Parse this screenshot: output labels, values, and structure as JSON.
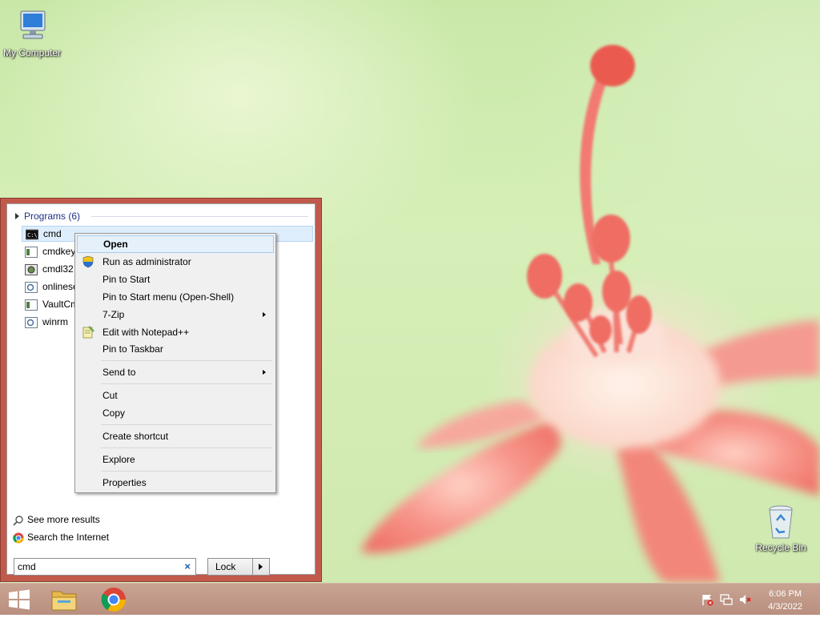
{
  "desktop": {
    "icons": [
      {
        "label": "My Computer",
        "icon": "computer-icon"
      },
      {
        "label": "Recycle Bin",
        "icon": "recycle-bin-icon"
      }
    ]
  },
  "start_menu": {
    "programs_header": "Programs (6)",
    "results": [
      {
        "label": "cmd",
        "icon": "console-icon",
        "selected": true
      },
      {
        "label": "cmdkey",
        "icon": "app-window-icon"
      },
      {
        "label": "cmdl32",
        "icon": "cmdl32-icon"
      },
      {
        "label": "onlinese",
        "icon": "gear-window-icon"
      },
      {
        "label": "VaultCm",
        "icon": "app-window-icon"
      },
      {
        "label": "winrm",
        "icon": "gear-window-icon"
      }
    ],
    "see_more": "See more results",
    "search_internet": "Search the Internet",
    "search": {
      "value": "cmd",
      "clear": "×"
    },
    "lock_label": "Lock"
  },
  "context_menu": {
    "items": [
      {
        "label": "Open",
        "bold": true,
        "highlighted": true
      },
      {
        "label": "Run as administrator",
        "icon": "uac-shield-icon"
      },
      {
        "label": "Pin to Start"
      },
      {
        "label": "Pin to Start menu (Open-Shell)"
      },
      {
        "label": "7-Zip",
        "submenu": true
      },
      {
        "label": "Edit with Notepad++",
        "icon": "notepad-plus-plus-icon"
      },
      {
        "label": "Pin to Taskbar"
      },
      {
        "label": "Send to",
        "submenu": true
      },
      {
        "label": "Cut"
      },
      {
        "label": "Copy"
      },
      {
        "label": "Create shortcut"
      },
      {
        "label": "Explore"
      },
      {
        "label": "Properties"
      }
    ]
  },
  "taskbar": {
    "items": [
      "windows-start-icon",
      "file-explorer-icon",
      "chrome-icon"
    ],
    "tray": [
      "action-center-flag-icon",
      "network-icon",
      "volume-muted-icon"
    ],
    "time": "6:06 PM",
    "date": "4/3/2022"
  },
  "colors": {
    "menu_border": "#c25a4c",
    "highlight": "#e5f0fb",
    "taskbar": "#c09a8a"
  }
}
